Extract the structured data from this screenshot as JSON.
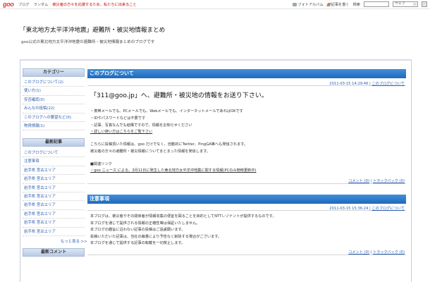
{
  "topbar": {
    "logo": "goo",
    "nav": [
      "ブログ",
      "ランダム"
    ],
    "notice": "被災者の方々を応援するため、私たちに出来ること",
    "photo_album": "フォトアルバム",
    "write_article": "記事を書く",
    "search_label": "検索",
    "search_scope": "ウェブ"
  },
  "header": {
    "title": "「東北地方太平洋沖地震」避難所・被災地情報まとめ",
    "description": "goo公式の東北地方太平洋沖地震の避難所・被災地情報まとめのブログです"
  },
  "sidebar": {
    "category_head": "カテゴリー",
    "categories": [
      {
        "label": "このブログについて",
        "count": "(2)"
      },
      {
        "label": "使い方",
        "count": "(1)"
      },
      {
        "label": "安否確認",
        "count": "(0)"
      },
      {
        "label": "みんなの投稿",
        "count": "(22)"
      },
      {
        "label": "このブログへの要望など",
        "count": "(0)"
      },
      {
        "label": "物資情報",
        "count": "(1)"
      }
    ],
    "recent_head": "最新記事",
    "recent": [
      "このブログについて",
      "注意事項",
      "岩手県 宮古エリア",
      "岩手県 宮古エリア",
      "岩手県 宮古エリア",
      "岩手県 宮古エリア",
      "岩手県 宮古エリア",
      "岩手県 宮古エリア",
      "岩手県 宮古エリア",
      "岩手県 宮古エリア"
    ],
    "more": "もっと見る >>",
    "comment_head": "最新コメント"
  },
  "posts": [
    {
      "category": "このブログについて",
      "datetime": "2011-03-15 14:29:46",
      "category_link": "このブログについて",
      "title": "「311@goo.jp」へ、避難所・被災地の情報をお送り下さい。",
      "lines": [
        "・携帯メールでも、PCメールでも、Webメールでも、インターネットメールであればOKです",
        "・IDやパスワードなどは不要です",
        "・記事、写真なんでも結構ですので、情報をお知らせください",
        "・詳しい使い方はこちらをご覧下さい",
        "こちらに投稿頂いた情報は、goo だけでなく、自動的にTwitter、PingGA等へも発信されます。",
        "被災者の方々の避難所・被災情報についてまとまった情報を発信します。",
        "■関連リンク",
        "・goo ニュース による、3月11日に発生した東北地方太平洋沖地震に関する情報(PCのみ随時更新中)"
      ],
      "comment": "コメント (0)",
      "trackback": "トラックバック (0)"
    },
    {
      "category": "注意事項",
      "datetime": "2011-03-15 15:36:24",
      "category_link": "このブログについて",
      "lines": [
        "本ブログは、被災者やその関係者が情報収集の便宜を図ることを目的としてNTTレゾナントが提供するものです。",
        "本ブログを通じて提供される情報の正確性等は保証いたしません。",
        "本ブログの趣旨に沿わない記事の投稿はご遠慮願います。",
        "投稿いただいた記事は、当社の裁量により予告なく削除する場合がございます。",
        "本ブログを通じて提供する記事の転載を一切禁止します。"
      ],
      "comment": "コメント (0)",
      "trackback": "トラックバック (0)"
    }
  ]
}
